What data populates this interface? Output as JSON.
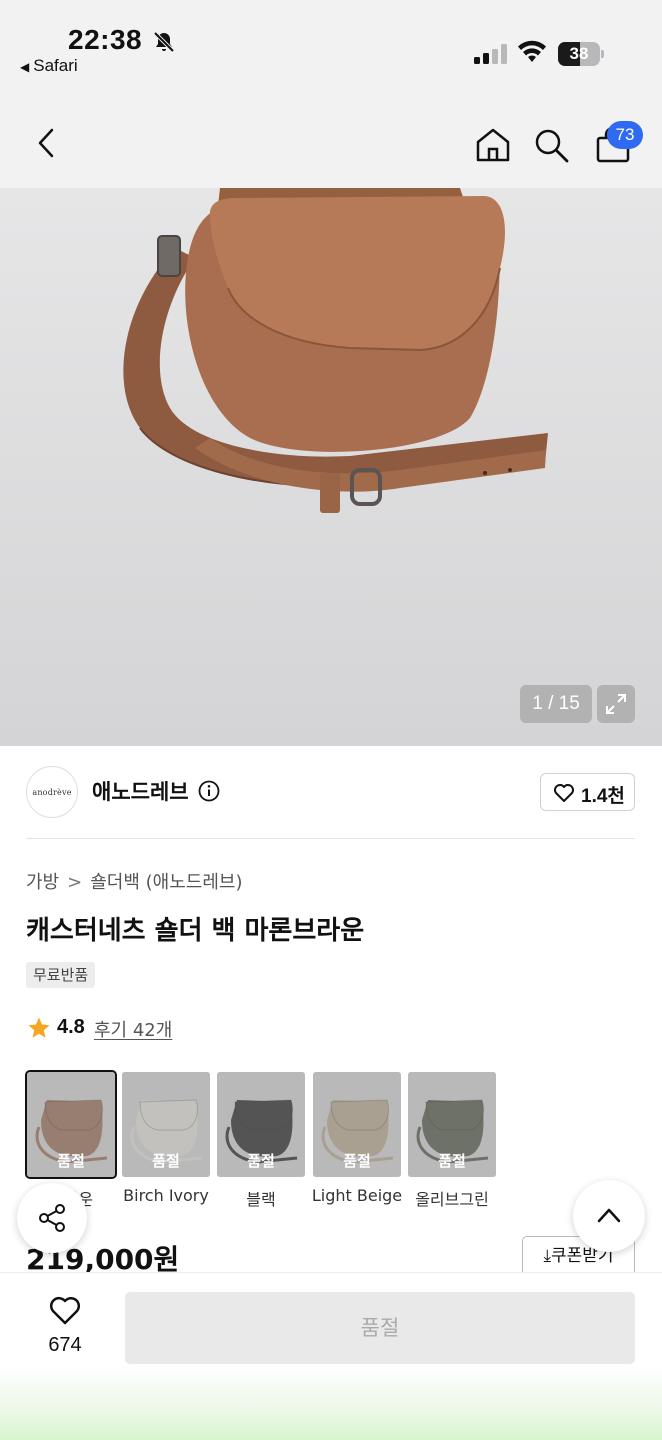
{
  "status_bar": {
    "time": "22:38",
    "back_app": "Safari",
    "battery": "38",
    "icons": [
      "bell-slash-icon",
      "signal-icon",
      "wifi-icon",
      "battery-icon"
    ]
  },
  "nav": {
    "cart_badge": "73",
    "icons": [
      "back-chevron-icon",
      "home-icon",
      "search-icon",
      "shopping-bag-icon"
    ]
  },
  "gallery": {
    "counter": "1 / 15"
  },
  "brand": {
    "logo_text": "anodrève",
    "name": "애노드레브",
    "likes": "1.4천"
  },
  "product": {
    "breadcrumb": [
      "가방",
      "숄더백 (애노드레브)"
    ],
    "title": "캐스터네츠 숄더 백 마론브라운",
    "tag": "무료반품",
    "rating": "4.8",
    "reviews": "후기 42개",
    "price": "219,000원",
    "coupon_label": "쿠폰받기"
  },
  "variants": [
    {
      "label": "브라운",
      "status": "품절",
      "color": "#9a6a50"
    },
    {
      "label": "Birch Ivory",
      "status": "품절",
      "color": "#e8e4dc"
    },
    {
      "label": "블랙",
      "status": "품절",
      "color": "#1e1e1e"
    },
    {
      "label": "Light Beige",
      "status": "품절",
      "color": "#b8a88f"
    },
    {
      "label": "올리브그린",
      "status": "품절",
      "color": "#4c5240"
    }
  ],
  "bottom_bar": {
    "wish_count": "674",
    "buy_label": "품절"
  },
  "colors": {
    "accent": "#2f6bf2",
    "star": "#f5a623",
    "bag": "#a86e4f"
  }
}
